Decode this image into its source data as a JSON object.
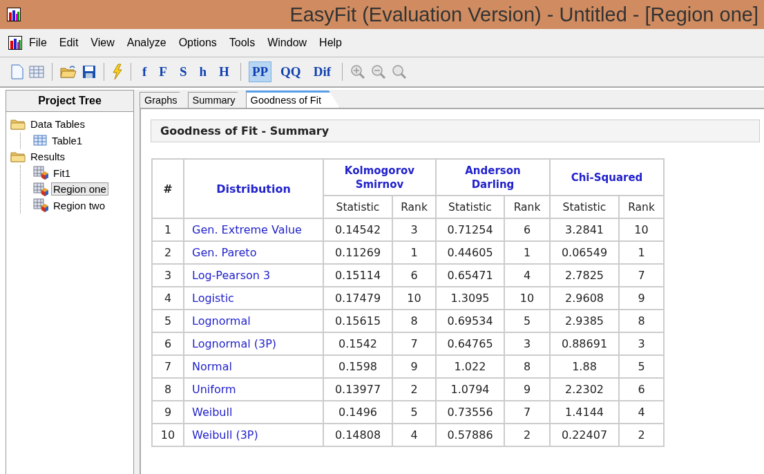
{
  "window": {
    "title": "EasyFit (Evaluation Version) - Untitled - [Region one]"
  },
  "menu": [
    "File",
    "Edit",
    "View",
    "Analyze",
    "Options",
    "Tools",
    "Window",
    "Help"
  ],
  "toolbar": [
    {
      "kind": "new-doc"
    },
    {
      "kind": "table"
    },
    {
      "kind": "separator"
    },
    {
      "kind": "open"
    },
    {
      "kind": "save"
    },
    {
      "kind": "separator"
    },
    {
      "kind": "fit"
    },
    {
      "kind": "separator"
    },
    {
      "kind": "text",
      "label": "f",
      "selected": false
    },
    {
      "kind": "text",
      "label": "F",
      "selected": false
    },
    {
      "kind": "text",
      "label": "S",
      "selected": false
    },
    {
      "kind": "text",
      "label": "h",
      "selected": false
    },
    {
      "kind": "text",
      "label": "H",
      "selected": false
    },
    {
      "kind": "separator"
    },
    {
      "kind": "text",
      "label": "PP",
      "selected": true
    },
    {
      "kind": "text",
      "label": "QQ",
      "selected": false
    },
    {
      "kind": "text",
      "label": "Dif",
      "selected": false
    },
    {
      "kind": "separator"
    },
    {
      "kind": "zoom-in"
    },
    {
      "kind": "zoom-out"
    },
    {
      "kind": "zoom"
    }
  ],
  "sidebar": {
    "title": "Project Tree",
    "tree": [
      {
        "label": "Data Tables",
        "kind": "folder",
        "selected": false,
        "children": [
          {
            "label": "Table1",
            "kind": "table",
            "selected": false
          }
        ]
      },
      {
        "label": "Results",
        "kind": "folder",
        "selected": false,
        "children": [
          {
            "label": "Fit1",
            "kind": "result",
            "selected": false
          },
          {
            "label": "Region one",
            "kind": "result",
            "selected": true
          },
          {
            "label": "Region two",
            "kind": "result",
            "selected": false
          }
        ]
      }
    ]
  },
  "tabs": [
    {
      "label": "Graphs",
      "selected": false
    },
    {
      "label": "Summary",
      "selected": false
    },
    {
      "label": "Goodness of Fit",
      "selected": true
    }
  ],
  "table": {
    "title": "Goodness of Fit - Summary",
    "number_header": "#",
    "distribution_header": "Distribution",
    "groups": [
      {
        "name": "Kolmogorov Smirnov",
        "sub_columns": [
          "Statistic",
          "Rank"
        ]
      },
      {
        "name": "Anderson Darling",
        "sub_columns": [
          "Statistic",
          "Rank"
        ]
      },
      {
        "name": "Chi-Squared",
        "sub_columns": [
          "Statistic",
          "Rank"
        ]
      }
    ],
    "rows": [
      {
        "number": "1",
        "distribution": "Gen. Extreme Value",
        "values": [
          "0.14542",
          "3",
          "0.71254",
          "6",
          "3.2841",
          "10"
        ]
      },
      {
        "number": "2",
        "distribution": "Gen. Pareto",
        "values": [
          "0.11269",
          "1",
          "0.44605",
          "1",
          "0.06549",
          "1"
        ]
      },
      {
        "number": "3",
        "distribution": "Log-Pearson 3",
        "values": [
          "0.15114",
          "6",
          "0.65471",
          "4",
          "2.7825",
          "7"
        ]
      },
      {
        "number": "4",
        "distribution": "Logistic",
        "values": [
          "0.17479",
          "10",
          "1.3095",
          "10",
          "2.9608",
          "9"
        ]
      },
      {
        "number": "5",
        "distribution": "Lognormal",
        "values": [
          "0.15615",
          "8",
          "0.69534",
          "5",
          "2.9385",
          "8"
        ]
      },
      {
        "number": "6",
        "distribution": "Lognormal (3P)",
        "values": [
          "0.1542",
          "7",
          "0.64765",
          "3",
          "0.88691",
          "3"
        ]
      },
      {
        "number": "7",
        "distribution": "Normal",
        "values": [
          "0.1598",
          "9",
          "1.022",
          "8",
          "1.88",
          "5"
        ]
      },
      {
        "number": "8",
        "distribution": "Uniform",
        "values": [
          "0.13977",
          "2",
          "1.0794",
          "9",
          "2.2302",
          "6"
        ]
      },
      {
        "number": "9",
        "distribution": "Weibull",
        "values": [
          "0.1496",
          "5",
          "0.73556",
          "7",
          "1.4144",
          "4"
        ]
      },
      {
        "number": "10",
        "distribution": "Weibull (3P)",
        "values": [
          "0.14808",
          "4",
          "0.57886",
          "2",
          "0.22407",
          "2"
        ]
      }
    ]
  }
}
